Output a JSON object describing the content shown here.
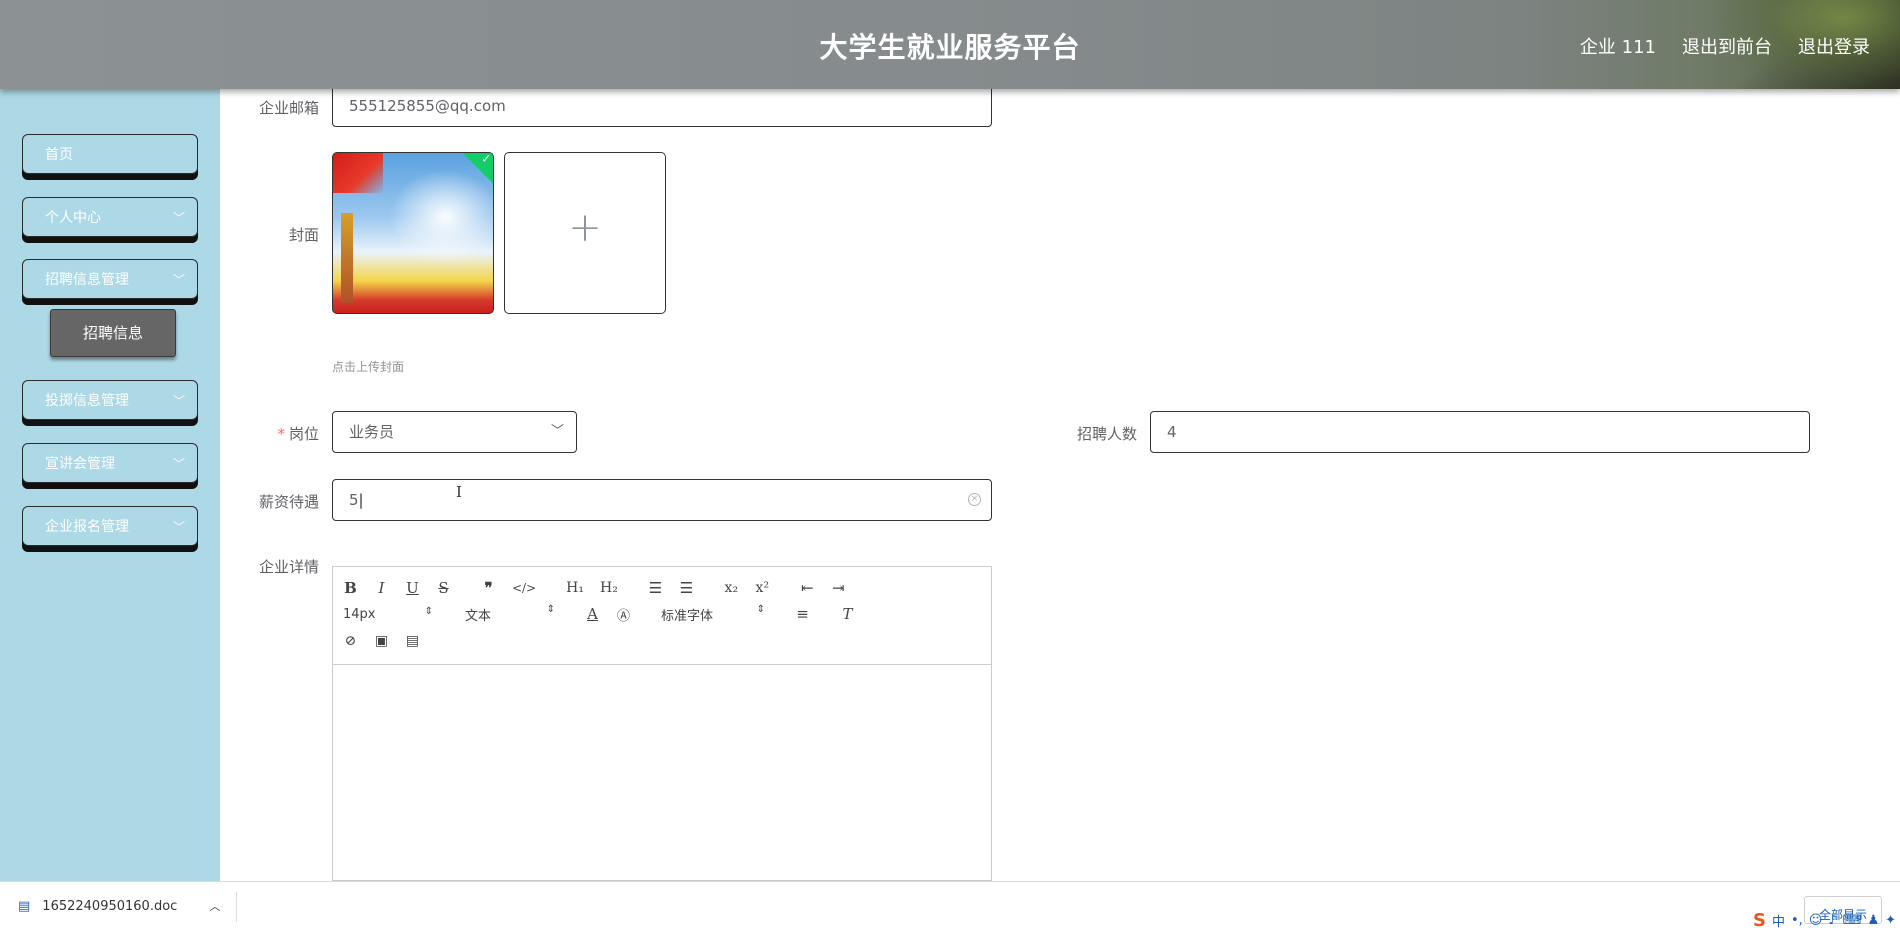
{
  "header": {
    "title": "大学生就业服务平台",
    "nav": [
      "企业 111",
      "退出到前台",
      "退出登录"
    ]
  },
  "sidebar": {
    "items": [
      {
        "label": "首页",
        "expandable": false
      },
      {
        "label": "个人中心",
        "expandable": true
      },
      {
        "label": "招聘信息管理",
        "expandable": true
      },
      {
        "label": "投掷信息管理",
        "expandable": true
      },
      {
        "label": "宣讲会管理",
        "expandable": true
      },
      {
        "label": "企业报名管理",
        "expandable": true
      }
    ],
    "sub_item": "招聘信息"
  },
  "form": {
    "email_label": "企业邮箱",
    "email_value": "555125855@qq.com",
    "cover_label": "封面",
    "cover_hint": "点击上传封面",
    "position_label": "岗位",
    "position_value": "业务员",
    "count_label": "招聘人数",
    "count_value": "4",
    "salary_label": "薪资待遇",
    "salary_value": "5",
    "details_label": "企业详情"
  },
  "editor": {
    "font_size": "14px",
    "block_type": "文本",
    "font_family": "标准字体"
  },
  "download_bar": {
    "file_name": "1652240950160.doc",
    "show_all": "全部显示",
    "ime_label": "中"
  },
  "colors": {
    "sidebar_bg": "#add8e6",
    "active_sub_bg": "#666666",
    "required": "#f56c6c"
  }
}
